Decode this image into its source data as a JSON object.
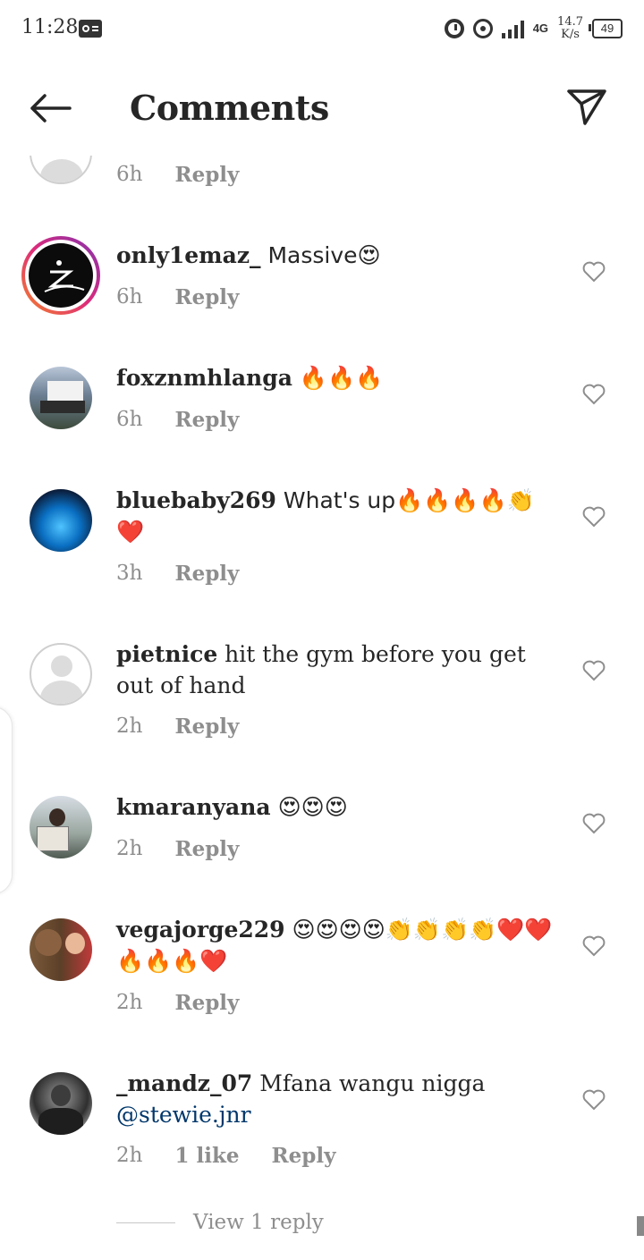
{
  "status_bar": {
    "time": "11:28",
    "network": "4G",
    "speed_value": "14.7",
    "speed_unit": "K/s",
    "battery": "49"
  },
  "header": {
    "title": "Comments"
  },
  "comments": [
    {
      "username": "",
      "text": "",
      "time": "6h",
      "reply_label": "Reply"
    },
    {
      "username": "only1emaz_",
      "text": " Massive😍",
      "time": "6h",
      "reply_label": "Reply"
    },
    {
      "username": "foxznmhlanga",
      "text": " 🔥🔥🔥",
      "time": "6h",
      "reply_label": "Reply"
    },
    {
      "username": "bluebaby269",
      "text": " What's up🔥🔥🔥🔥👏❤️",
      "time": "3h",
      "reply_label": "Reply"
    },
    {
      "username": "pietnice",
      "text": " hit the gym before you get out of hand",
      "time": "2h",
      "reply_label": "Reply"
    },
    {
      "username": "kmaranyana",
      "text": " 😍😍😍",
      "time": "2h",
      "reply_label": "Reply"
    },
    {
      "username": "vegajorge229",
      "text": " 😍😍😍😍👏👏👏👏❤️❤️🔥🔥🔥❤️",
      "time": "2h",
      "reply_label": "Reply"
    },
    {
      "username": "_mandz_07",
      "text": " Mfana wangu nigga ",
      "mention": "@stewie.jnr",
      "time": "2h",
      "likes": "1 like",
      "reply_label": "Reply"
    }
  ],
  "view_replies": "View 1 reply",
  "colors": {
    "text": "#262626",
    "meta": "#8e8e8e",
    "mention": "#00376b",
    "story_ring_start": "#f58529",
    "story_ring_end": "#dd2a7b"
  },
  "icons": [
    "back-arrow-icon",
    "send-icon",
    "heart-icon",
    "alarm-icon",
    "hotspot-icon",
    "signal-icon",
    "battery-icon",
    "message-icon"
  ]
}
